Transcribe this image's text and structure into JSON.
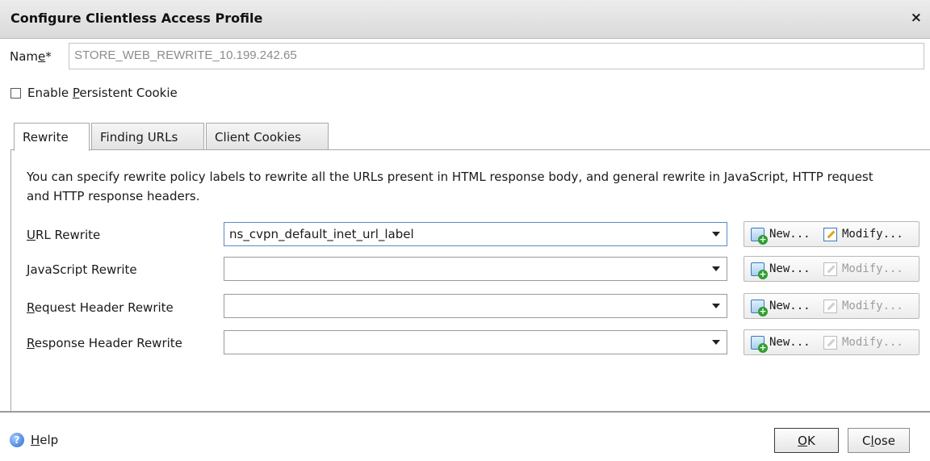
{
  "dialog": {
    "title": "Configure Clientless Access Profile",
    "close_glyph": "×"
  },
  "name": {
    "label_pre": "Nam",
    "label_key": "e",
    "label_post": "*",
    "value": "STORE_WEB_REWRITE_10.199.242.65"
  },
  "persistent_cookie": {
    "label_pre": "Enable ",
    "label_key": "P",
    "label_post": "ersistent Cookie",
    "checked": false
  },
  "tabs": [
    {
      "label": "Rewrite",
      "active": true
    },
    {
      "label": "Finding URLs",
      "active": false
    },
    {
      "label": "Client Cookies",
      "active": false
    }
  ],
  "description": "You can specify rewrite policy labels to rewrite all the URLs present in HTML response body, and general rewrite in JavaScript, HTTP request and HTTP response headers.",
  "rows": [
    {
      "label_key": "U",
      "label_rest": "RL Rewrite",
      "value": "ns_cvpn_default_inet_url_label",
      "new_label": "New...",
      "modify_label": "Modify...",
      "modify_enabled": true
    },
    {
      "label_key": "J",
      "label_rest": "avaScript Rewrite",
      "value": "",
      "new_label": "New...",
      "modify_label": "Modify...",
      "modify_enabled": false
    },
    {
      "label_key": "R",
      "label_rest": "equest Header Rewrite",
      "value": "",
      "new_label": "New...",
      "modify_label": "Modify...",
      "modify_enabled": false
    },
    {
      "label_key": "R",
      "label_rest": "esponse Header Rewrite",
      "value": "",
      "new_label": "New...",
      "modify_label": "Modify...",
      "modify_enabled": false
    }
  ],
  "footer": {
    "help_key": "H",
    "help_rest": "elp",
    "ok_key": "O",
    "ok_rest": "K",
    "close_pre": "C",
    "close_key": "l",
    "close_rest": "ose"
  },
  "colors": {
    "titlebar": "#e1e1e1",
    "accent": "#3a78b8",
    "disabled_text": "#9d9d9d",
    "field_text": "#8c8c8c"
  },
  "icons": {
    "new": "new-icon",
    "modify": "modify-icon",
    "help": "help-icon",
    "dropdown": "dropdown-arrow-icon"
  }
}
